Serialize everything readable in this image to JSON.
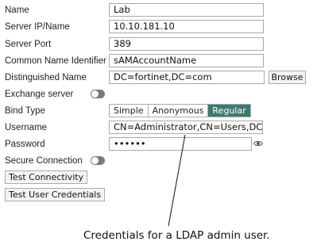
{
  "form": {
    "name": {
      "label": "Name",
      "value": "Lab"
    },
    "server_ip": {
      "label": "Server IP/Name",
      "value": "10.10.181.10"
    },
    "server_port": {
      "label": "Server Port",
      "value": "389"
    },
    "cn_identifier": {
      "label": "Common Name Identifier",
      "value": "sAMAccountName"
    },
    "distinguished_name": {
      "label": "Distinguished Name",
      "value": "DC=fortinet,DC=com",
      "browse_label": "Browse"
    },
    "exchange_server": {
      "label": "Exchange server",
      "enabled": false
    },
    "bind_type": {
      "label": "Bind Type",
      "options": [
        "Simple",
        "Anonymous",
        "Regular"
      ],
      "selected": "Regular"
    },
    "username": {
      "label": "Username",
      "value": "CN=Administrator,CN=Users,DC=TAC,"
    },
    "password": {
      "label": "Password",
      "value": "••••••",
      "reveal_icon": "eye-icon"
    },
    "secure_connection": {
      "label": "Secure Connection",
      "enabled": false
    }
  },
  "buttons": {
    "test_connectivity": "Test Connectivity",
    "test_user_credentials": "Test User Credentials"
  },
  "annotation": {
    "caption": "Credentials for a LDAP admin user."
  },
  "colors": {
    "accent": "#3d7a6e",
    "toggle_off": "#7a7a7a"
  }
}
